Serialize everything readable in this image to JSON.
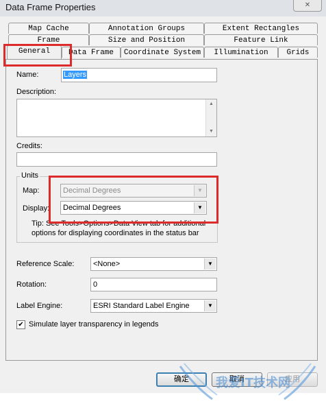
{
  "window": {
    "title": "Data Frame Properties",
    "close_label": "✕"
  },
  "tabs": {
    "row1": [
      "Map Cache",
      "Annotation Groups",
      "Extent Rectangles"
    ],
    "row2": [
      "Frame",
      "Size and Position",
      "Feature Link"
    ],
    "row3": [
      "General",
      "Data Frame",
      "Coordinate System",
      "Illumination",
      "Grids"
    ]
  },
  "general": {
    "name_label": "Name:",
    "name_value": "Layers",
    "description_label": "Description:",
    "description_value": "",
    "credits_label": "Credits:",
    "credits_value": "",
    "units": {
      "title": "Units",
      "map_label": "Map:",
      "map_value": "Decimal Degrees",
      "display_label": "Display:",
      "display_value": "Decimal Degrees",
      "tip": "Tip: See Tools>Options>Data View tab for additional options for displaying coordinates in the status bar"
    },
    "reference_scale_label": "Reference Scale:",
    "reference_scale_value": "<None>",
    "rotation_label": "Rotation:",
    "rotation_value": "0",
    "label_engine_label": "Label Engine:",
    "label_engine_value": "ESRI Standard Label Engine",
    "simulate_label": "Simulate layer transparency in legends",
    "simulate_checked": true
  },
  "buttons": {
    "ok": "确定",
    "cancel": "取消",
    "apply": "应用"
  },
  "watermark_text": "我爱IT技术网"
}
